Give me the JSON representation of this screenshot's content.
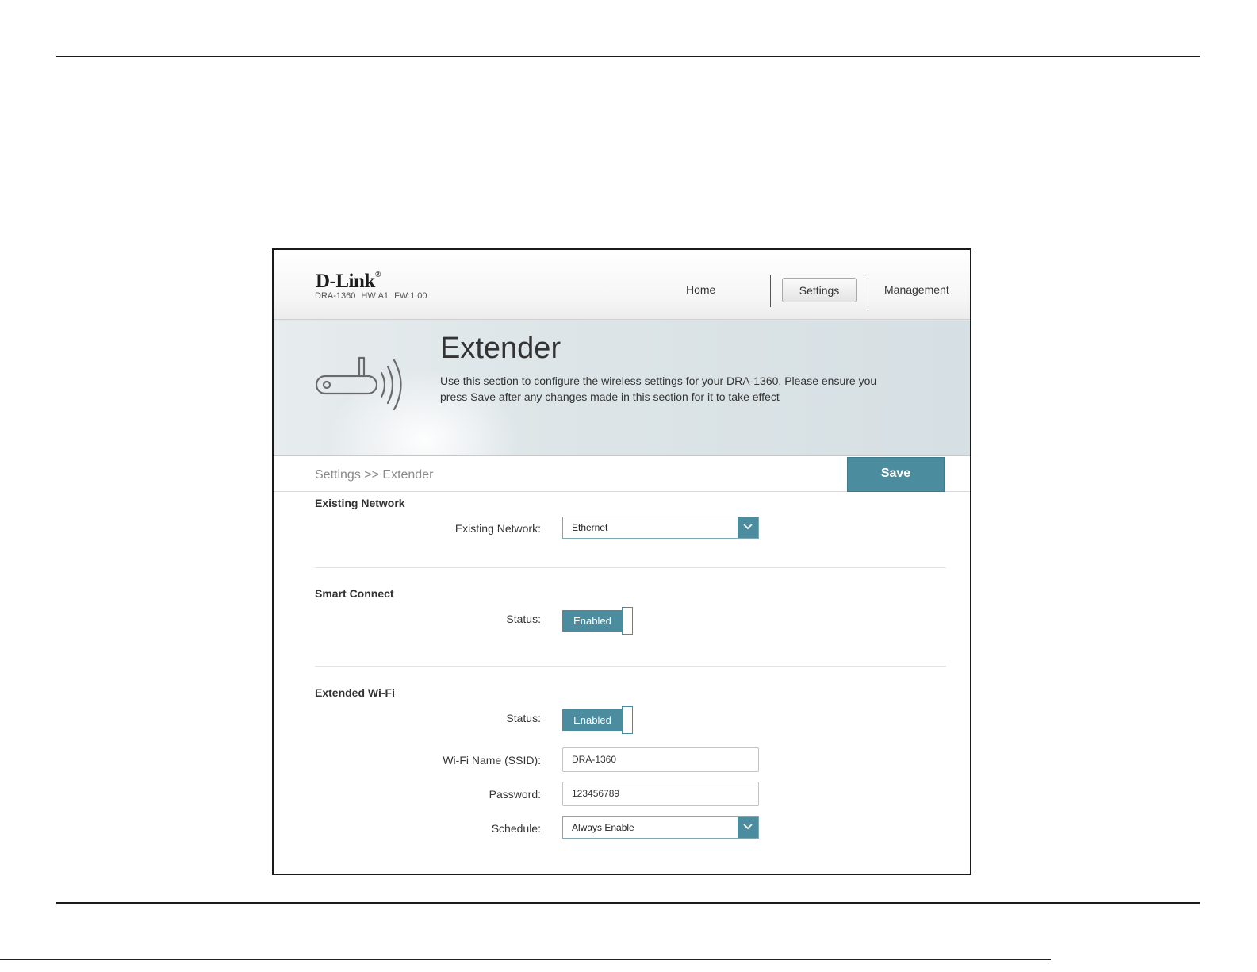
{
  "header": {
    "brand": "D-Link",
    "brand_mark": "®",
    "device_info": "DRA-1360  HW:A1  FW:1.00",
    "nav": {
      "home": "Home",
      "settings": "Settings",
      "management": "Management"
    }
  },
  "banner": {
    "title": "Extender",
    "description": "Use this section to configure the wireless settings for your DRA-1360. Please ensure you press Save after any changes made in this section for it to take effect",
    "icon": "router-wireless-icon"
  },
  "breadcrumb": "Settings >> Extender",
  "save_label": "Save",
  "existing_network": {
    "title": "Existing Network",
    "label": "Existing Network:",
    "value": "Ethernet"
  },
  "smart_connect": {
    "title": "Smart Connect",
    "status_label": "Status:",
    "status_value": "Enabled"
  },
  "extended_wifi": {
    "title": "Extended Wi-Fi",
    "status_label": "Status:",
    "status_value": "Enabled",
    "ssid_label": "Wi-Fi Name (SSID):",
    "ssid_value": "DRA-1360",
    "password_label": "Password:",
    "password_value": "123456789",
    "schedule_label": "Schedule:",
    "schedule_value": "Always Enable"
  },
  "colors": {
    "accent": "#4b8d9f"
  }
}
